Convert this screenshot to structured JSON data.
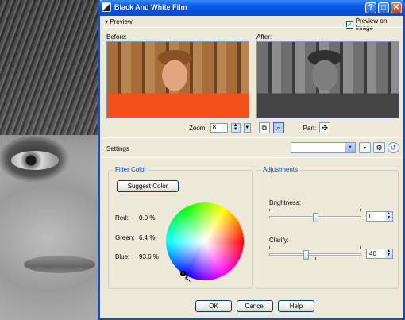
{
  "window": {
    "title": "Black And White Film",
    "help_label": "?",
    "max_label": "□",
    "close_label": "✕"
  },
  "preview": {
    "section_label": "Preview",
    "preview_on_image_label": "Preview on Image",
    "preview_on_image_checked": true,
    "before_label": "Before:",
    "after_label": "After:",
    "zoom_label": "Zoom:",
    "zoom_value": "8",
    "pan_label": "Pan:"
  },
  "settings": {
    "label": "Settings",
    "preset_value": ""
  },
  "filter_color": {
    "group_title": "Filter Color",
    "suggest_button": "Suggest Color",
    "red_label": "Red:",
    "red_value": "0.0 %",
    "green_label": "Green:",
    "green_value": "6.4 %",
    "blue_label": "Blue:",
    "blue_value": "93.6 %"
  },
  "adjustments": {
    "group_title": "Adjustments",
    "brightness_label": "Brightness:",
    "brightness_value": "0",
    "brightness_position": 0.5,
    "clarify_label": "Clarify:",
    "clarify_value": "40",
    "clarify_position": 0.4
  },
  "buttons": {
    "ok": "OK",
    "cancel": "Cancel",
    "help": "Help"
  },
  "colors": {
    "titlebar": "#0b5fe8",
    "dialog_bg": "#ece9d8",
    "group_title": "#0046d5"
  },
  "icons": [
    "window-app-icon",
    "help-icon",
    "maximize-icon",
    "close-icon",
    "zoom-fit-icon",
    "zoom-tool-icon",
    "pan-icon",
    "save-preset-icon",
    "manage-presets-icon",
    "reset-icon"
  ]
}
